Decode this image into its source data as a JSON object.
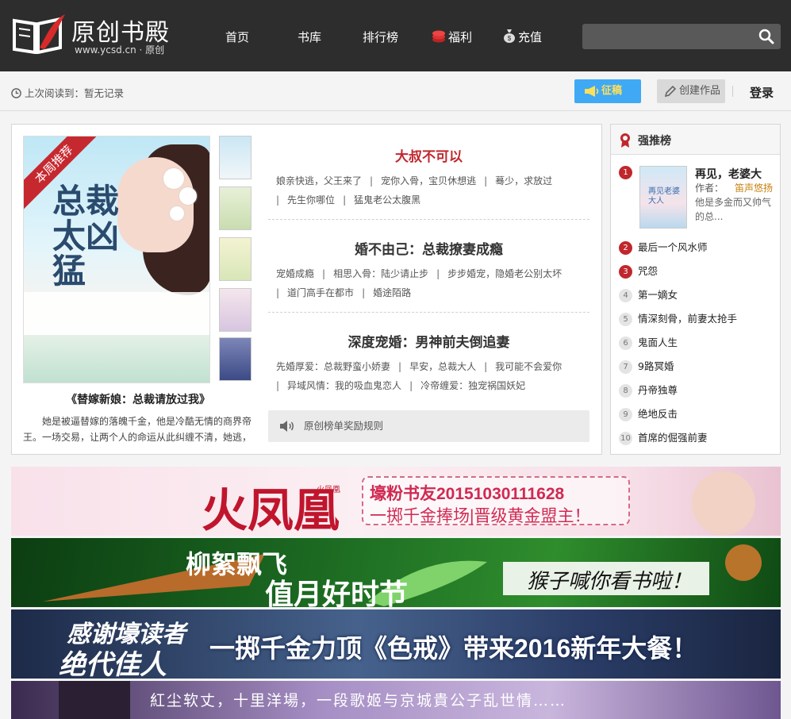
{
  "header": {
    "logo_name": "原创书殿",
    "logo_url": "www.ycsd.cn · 原创",
    "nav": [
      {
        "label": "首页",
        "icon": ""
      },
      {
        "label": "书库",
        "icon": ""
      },
      {
        "label": "排行榜",
        "icon": ""
      },
      {
        "label": "福利",
        "icon": "coins-icon"
      },
      {
        "label": "充值",
        "icon": "money-bag-icon"
      }
    ],
    "search_placeholder": ""
  },
  "subbar": {
    "last_read_label": "上次阅读到：暂无记录",
    "zheng_label": "征稿",
    "create_label": "创建作品",
    "login_label": "登录"
  },
  "featured": {
    "ribbon": "本周推荐",
    "cover_title": "总裁太凶猛",
    "title": "《替嫁新娘：总裁请放过我》",
    "description": "她是被逼替嫁的落魄千金，他是冷酷无情的商界帝王。一场交易，让两个人的命运从此纠缠不清，她逃，他追，她插翅难飞……"
  },
  "stories": [
    {
      "title": "大叔不可以",
      "highlight": true,
      "tags": [
        "娘亲快逃，父王来了",
        "宠你入骨，宝贝休想逃",
        "蓦少，求放过",
        "先生你哪位",
        "猛鬼老公太腹黑"
      ]
    },
    {
      "title": "婚不由己：总裁撩妻成瘾",
      "highlight": false,
      "tags": [
        "宠婚成瘾",
        "相思入骨：陆少请止步",
        "步步婚宠，隐婚老公别太坏",
        "道门高手在都市",
        "婚途陌路"
      ]
    },
    {
      "title": "深度宠婚：男神前夫倒追妻",
      "highlight": false,
      "tags": [
        "先婚厚爱：总裁野蛮小娇妻",
        "早安，总裁大人",
        "我可能不会爱你",
        "异域风情：我的吸血鬼恋人",
        "冷帝缠爱：独宠祸国妖妃"
      ]
    }
  ],
  "notice": "原创榜单奖励规则",
  "ranking": {
    "title": "强推榜",
    "first": {
      "rank": "1",
      "title": "再见，老婆大",
      "author_label": "作者：",
      "author": "笛声悠扬",
      "desc": "他是多金而又帅气的总...",
      "cover_title": "再见老婆大人"
    },
    "items": [
      {
        "rank": "2",
        "title": "最后一个风水师"
      },
      {
        "rank": "3",
        "title": "咒怨"
      },
      {
        "rank": "4",
        "title": "第一嫡女"
      },
      {
        "rank": "5",
        "title": "情深刻骨，前妻太抢手"
      },
      {
        "rank": "6",
        "title": "鬼面人生"
      },
      {
        "rank": "7",
        "title": "9路冥婚"
      },
      {
        "rank": "8",
        "title": "丹帝独尊"
      },
      {
        "rank": "9",
        "title": "绝地反击"
      },
      {
        "rank": "10",
        "title": "首席的倔强前妻"
      }
    ]
  },
  "banners": [
    {
      "name": "火凤凰",
      "sub": "火凤凰",
      "line": "壕粉书友20151030111628",
      "line2": "一掷千金捧场|晋级黄金盟主！"
    },
    {
      "name": "柳絮飘飞",
      "line": "值月好时节",
      "line2": "猴子喊你看书啦！"
    },
    {
      "name": "感谢壕读者",
      "line": "绝代佳人",
      "line2": "一掷千金力顶《色戒》带来2016新年大餐！"
    },
    {
      "name": "紅尘软丈，十里洋場，一段歌姬与京城貴公子乱世情……"
    }
  ],
  "colors": {
    "accent_red": "#c0272d",
    "topbar": "#2d2d2d",
    "button_blue": "#3fa9f5"
  }
}
